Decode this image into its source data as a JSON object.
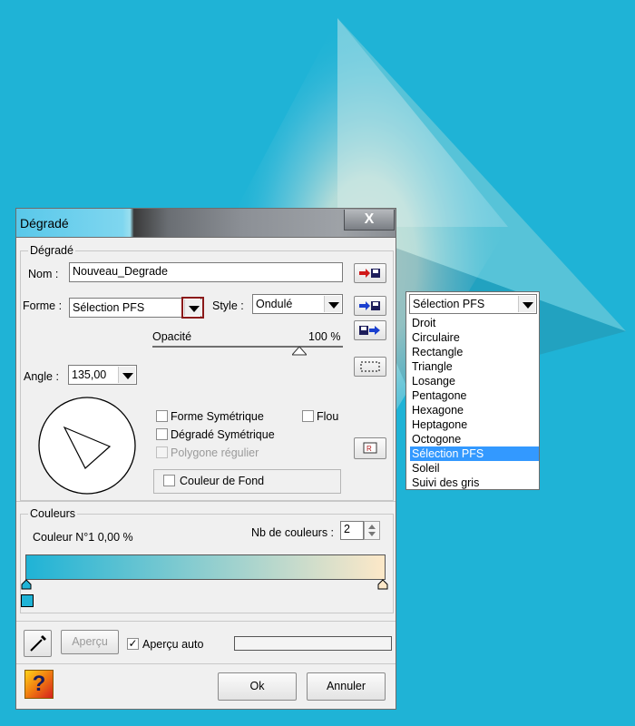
{
  "dialog": {
    "title": "Dégradé",
    "close_label": "X",
    "gradient_group": {
      "label": "Dégradé",
      "name_label": "Nom :",
      "name_value": "Nouveau_Degrade",
      "shape_label": "Forme :",
      "shape_value": "Sélection PFS",
      "style_label": "Style :",
      "style_value": "Ondulé",
      "opacity_label": "Opacité",
      "opacity_value": "100 %",
      "opacity_fraction": 1.0,
      "angle_label": "Angle :",
      "angle_value": "135,00",
      "checkboxes": [
        {
          "label": "Forme Symétrique",
          "checked": false,
          "enabled": true
        },
        {
          "label": "Flou",
          "checked": false,
          "enabled": true
        },
        {
          "label": "Dégradé Symétrique",
          "checked": false,
          "enabled": true
        },
        {
          "label": "Polygone régulier",
          "checked": false,
          "enabled": false
        }
      ],
      "background_color_label": "Couleur de Fond"
    },
    "colors_group": {
      "label": "Couleurs",
      "color_info": "Couleur N°1 0,00 %",
      "count_label": "Nb de couleurs :",
      "count_value": "2",
      "gradient_start": "#1fb3d6",
      "gradient_end": "#fde8c8"
    },
    "bottom": {
      "preview_button": "Aperçu",
      "auto_preview_label": "Aperçu auto",
      "auto_preview_checked": true,
      "ok_button": "Ok",
      "cancel_button": "Annuler"
    },
    "side_icons": [
      "load-gradient-icon",
      "save-gradient-icon",
      "export-gradient-icon",
      "selection-rect-icon",
      "reset-icon"
    ]
  },
  "shape_dropdown": {
    "value": "Sélection PFS",
    "options": [
      "Droit",
      "Circulaire",
      "Rectangle",
      "Triangle",
      "Losange",
      "Pentagone",
      "Hexagone",
      "Heptagone",
      "Octogone",
      "Sélection PFS",
      "Soleil",
      "Suivi des gris"
    ],
    "selected_index": 9
  }
}
